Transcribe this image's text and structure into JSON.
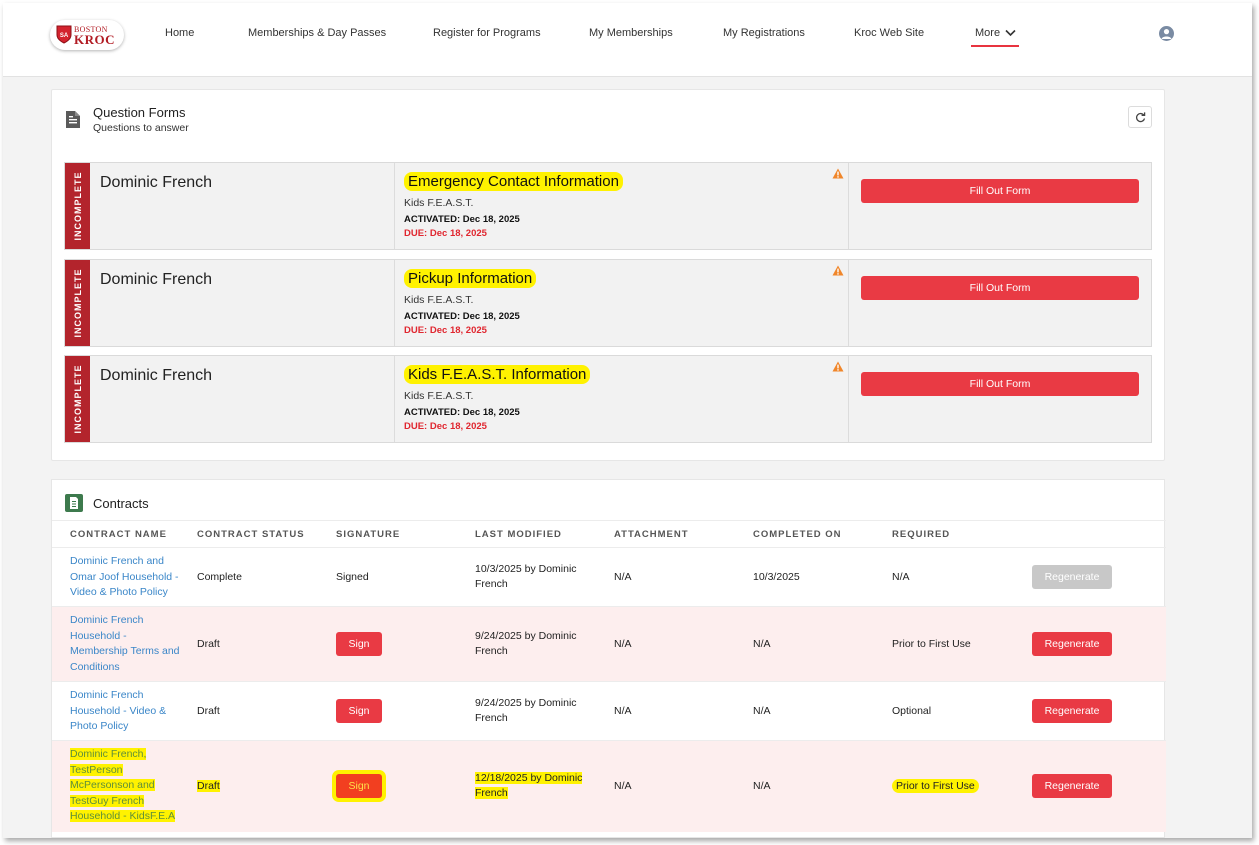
{
  "nav": {
    "logo_top": "BOSTON",
    "logo_main": "KROC",
    "links": [
      {
        "label": "Home"
      },
      {
        "label": "Memberships & Day Passes"
      },
      {
        "label": "Register for Programs"
      },
      {
        "label": "My Memberships"
      },
      {
        "label": "My Registrations"
      },
      {
        "label": "Kroc Web Site"
      }
    ],
    "more_label": "More",
    "accent": "#e8343f"
  },
  "question_forms": {
    "title": "Question Forms",
    "subtitle": "Questions to answer",
    "rows": [
      {
        "status": "INCOMPLETE",
        "person": "Dominic French",
        "form": "Emergency Contact Information",
        "program": "Kids F.E.A.S.T.",
        "activated_label": "ACTIVATED:",
        "activated": "Dec 18, 2025",
        "due_label": "DUE:",
        "due": "Dec 18, 2025",
        "button": "Fill Out Form"
      },
      {
        "status": "INCOMPLETE",
        "person": "Dominic French",
        "form": "Pickup Information",
        "program": "Kids F.E.A.S.T.",
        "activated_label": "ACTIVATED:",
        "activated": "Dec 18, 2025",
        "due_label": "DUE:",
        "due": "Dec 18, 2025",
        "button": "Fill Out Form"
      },
      {
        "status": "INCOMPLETE",
        "person": "Dominic French",
        "form": "Kids F.E.A.S.T. Information",
        "program": "Kids F.E.A.S.T.",
        "activated_label": "ACTIVATED:",
        "activated": "Dec 18, 2025",
        "due_label": "DUE:",
        "due": "Dec 18, 2025",
        "button": "Fill Out Form"
      }
    ]
  },
  "contracts": {
    "title": "Contracts",
    "columns": [
      "CONTRACT NAME",
      "CONTRACT STATUS",
      "SIGNATURE",
      "LAST MODIFIED",
      "ATTACHMENT",
      "COMPLETED ON",
      "REQUIRED"
    ],
    "rows": [
      {
        "name_lines": [
          "Dominic French and",
          "Omar Joof Household -",
          "Video & Photo Policy"
        ],
        "status": "Complete",
        "signature": "Signed",
        "modified_lines": [
          "10/3/2025 by Dominic",
          "French"
        ],
        "attachment": "N/A",
        "completed": "10/3/2025",
        "required": "N/A",
        "regenerate": "Regenerate"
      },
      {
        "name_lines": [
          "Dominic French",
          "Household -",
          "Membership Terms and",
          "Conditions"
        ],
        "status": "Draft",
        "signature": "Sign",
        "modified_lines": [
          "9/24/2025 by Dominic",
          "French"
        ],
        "attachment": "N/A",
        "completed": "N/A",
        "required": "Prior to First Use",
        "regenerate": "Regenerate"
      },
      {
        "name_lines": [
          "Dominic French",
          "Household - Video &",
          "Photo Policy"
        ],
        "status": "Draft",
        "signature": "Sign",
        "modified_lines": [
          "9/24/2025 by Dominic",
          "French"
        ],
        "attachment": "N/A",
        "completed": "N/A",
        "required": "Optional",
        "regenerate": "Regenerate"
      },
      {
        "name_lines": [
          "Dominic French,",
          "TestPerson",
          "McPersonson and",
          "TestGuy French",
          "Household - KidsF.E.A"
        ],
        "status": "Draft",
        "signature": "Sign",
        "modified_lines": [
          "12/18/2025 by Dominic",
          "French"
        ],
        "attachment": "N/A",
        "completed": "N/A",
        "required": "Prior to First Use",
        "regenerate": "Regenerate"
      }
    ]
  },
  "colors": {
    "button_red": "#e93a44",
    "badge_red": "#b3242c",
    "due_red": "#e0262f",
    "link_blue": "#3a86c8",
    "highlight": "#fff200"
  }
}
